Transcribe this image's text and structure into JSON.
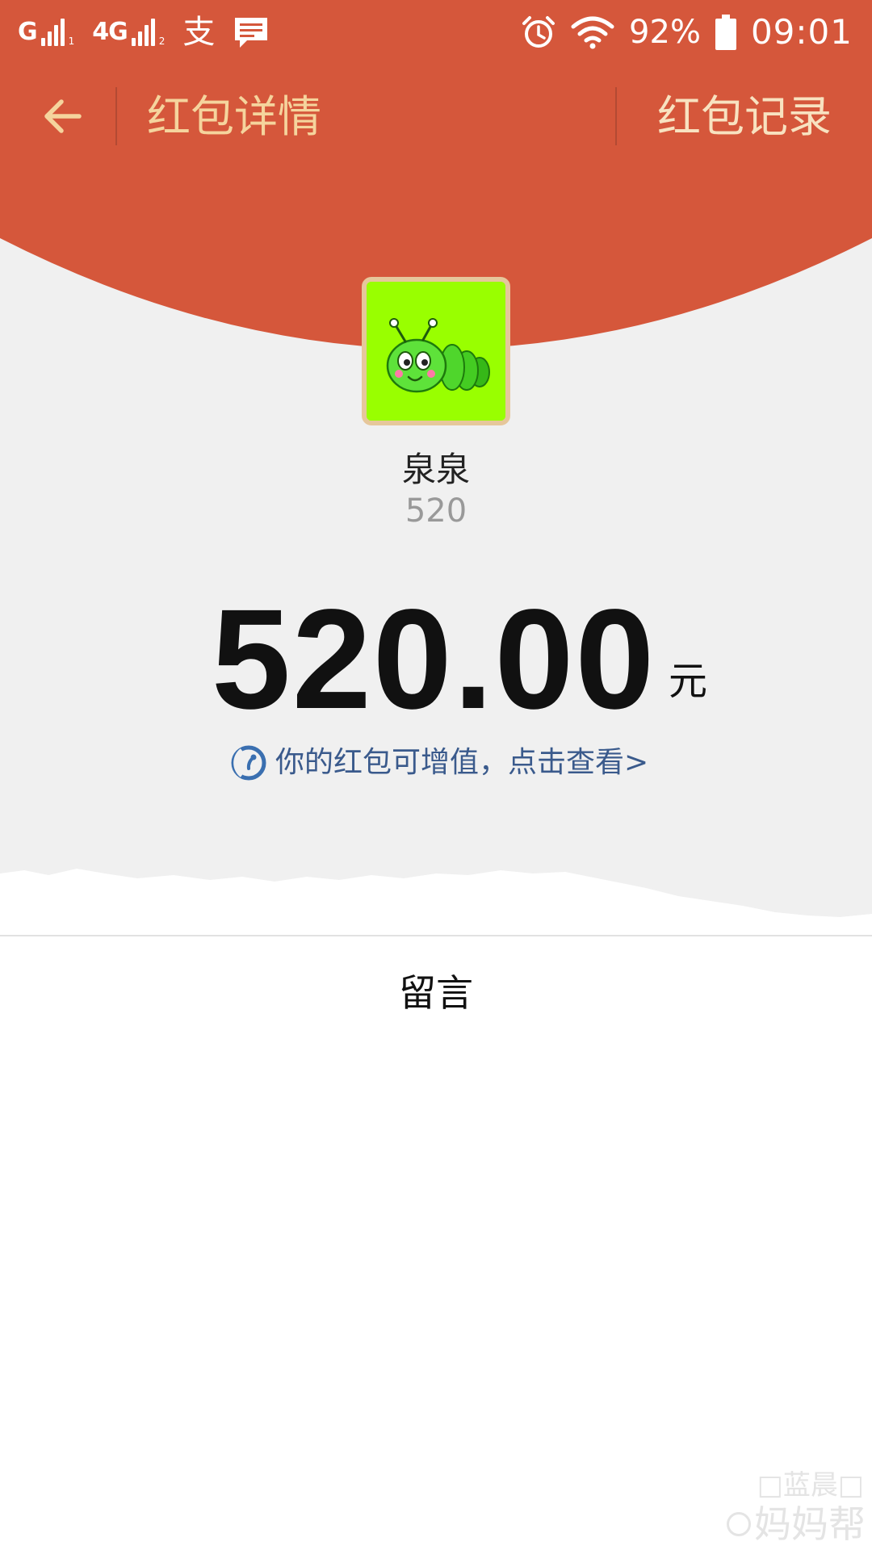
{
  "status_bar": {
    "sim1_label": "G",
    "sim1_index": "1",
    "sim2_label": "4G",
    "sim2_index": "2",
    "alipay_glyph": "支",
    "battery_percent": "92%",
    "time": "09:01",
    "icons": [
      "signal-icon",
      "alipay-icon",
      "message-icon",
      "alarm-icon",
      "wifi-icon",
      "battery-icon"
    ]
  },
  "nav": {
    "title": "红包详情",
    "right_action": "红包记录"
  },
  "sender": {
    "name": "泉泉",
    "note": "520"
  },
  "amount": {
    "value": "520.00",
    "unit": "元"
  },
  "promo": {
    "text": "你的红包可增值，点击查看>"
  },
  "message_section": {
    "label": "留言"
  },
  "watermark": {
    "top": "□蓝晨□",
    "bottom": "妈妈帮"
  },
  "colors": {
    "header_red": "#d5573b",
    "nav_title": "#f5d49d",
    "nav_right": "#f8e2c0",
    "avatar_bg": "#99ff00",
    "avatar_border": "#e6c79b",
    "promo_text": "#3a5a8c",
    "page_grey": "#f0f0f0"
  }
}
